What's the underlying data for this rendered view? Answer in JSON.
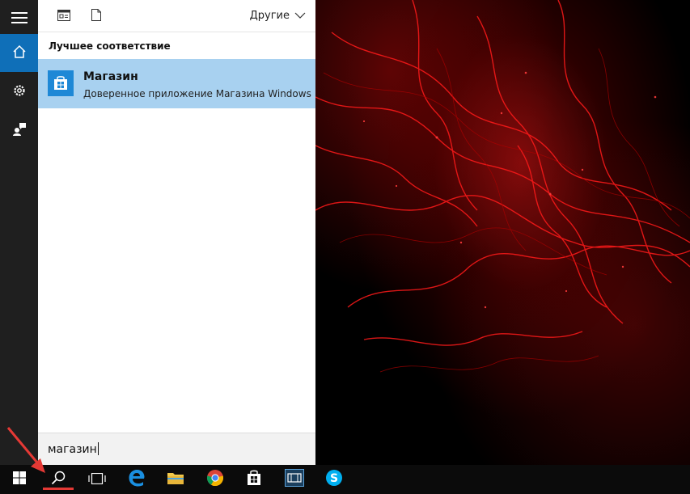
{
  "left_rail": {
    "items": [
      {
        "icon": "hamburger-icon"
      },
      {
        "icon": "home-icon"
      },
      {
        "icon": "settings-icon"
      },
      {
        "icon": "feedback-icon"
      }
    ]
  },
  "toolbar": {
    "other_label": "Другие"
  },
  "results": {
    "heading": "Лучшее соответствие",
    "best_match": {
      "title": "Магазин",
      "subtitle": "Доверенное приложение Магазина Windows"
    }
  },
  "search": {
    "value": "магазин"
  },
  "taskbar": {
    "items": [
      "start-icon",
      "search-icon",
      "task-view-icon",
      "edge-icon",
      "file-explorer-icon",
      "chrome-icon",
      "store-icon",
      "media-app-icon",
      "skype-icon"
    ]
  },
  "colors": {
    "accent": "#0f6fb8",
    "selected_result": "#a8d1f0",
    "annotation": "#e53935"
  }
}
